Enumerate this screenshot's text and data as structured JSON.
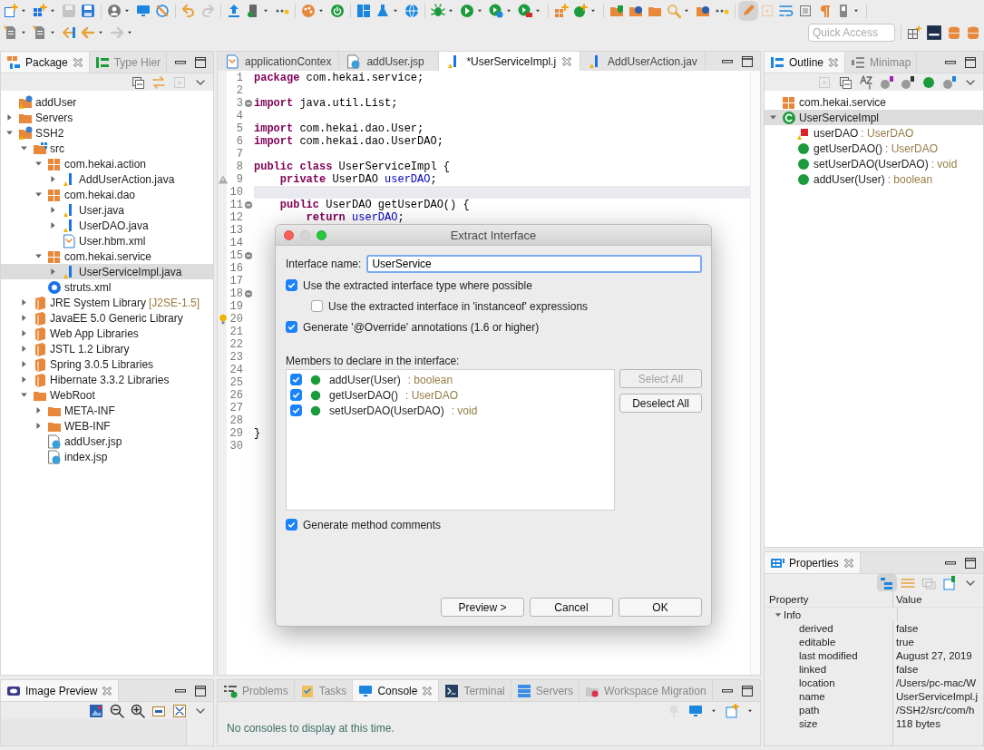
{
  "toolbar": {
    "quick_access": {
      "placeholder": "Quick Access"
    }
  },
  "package_explorer": {
    "tabs": [
      {
        "label": "Package",
        "selected": true
      },
      {
        "label": "Type Hier",
        "selected": false
      }
    ],
    "tree": [
      {
        "label": "addUser",
        "kind": "project",
        "selected": false
      },
      {
        "label": "Servers",
        "kind": "folder",
        "expanded": false,
        "selected": false
      },
      {
        "label": "SSH2",
        "kind": "project",
        "expanded": true,
        "selected": false,
        "children": [
          {
            "label": "src",
            "kind": "source",
            "expanded": true,
            "selected": false,
            "children": [
              {
                "label": "com.hekai.action",
                "kind": "package",
                "expanded": true,
                "selected": false,
                "children": [
                  {
                    "label": "AddUserAction.java",
                    "kind": "java",
                    "expanded": false,
                    "selected": false
                  }
                ]
              },
              {
                "label": "com.hekai.dao",
                "kind": "package",
                "expanded": true,
                "selected": false,
                "children": [
                  {
                    "label": "User.java",
                    "kind": "java",
                    "expanded": false,
                    "selected": false
                  },
                  {
                    "label": "UserDAO.java",
                    "kind": "java",
                    "expanded": false,
                    "selected": false
                  },
                  {
                    "label": "User.hbm.xml",
                    "kind": "xml",
                    "selected": false
                  }
                ]
              },
              {
                "label": "com.hekai.service",
                "kind": "package",
                "expanded": true,
                "selected": false,
                "children": [
                  {
                    "label": "UserServiceImpl.java",
                    "kind": "java",
                    "expanded": false,
                    "selected": true
                  }
                ]
              },
              {
                "label": "struts.xml",
                "kind": "config",
                "selected": false
              }
            ]
          },
          {
            "label": "JRE System Library",
            "suffix": "[J2SE-1.5]",
            "kind": "library",
            "expanded": false,
            "selected": false
          },
          {
            "label": "JavaEE 5.0 Generic Library",
            "kind": "library",
            "expanded": false,
            "selected": false
          },
          {
            "label": "Web App Libraries",
            "kind": "library",
            "expanded": false,
            "selected": false
          },
          {
            "label": "JSTL 1.2 Library",
            "kind": "library",
            "expanded": false,
            "selected": false
          },
          {
            "label": "Spring 3.0.5 Libraries",
            "kind": "library",
            "expanded": false,
            "selected": false
          },
          {
            "label": "Hibernate 3.3.2 Libraries",
            "kind": "library",
            "expanded": false,
            "selected": false
          },
          {
            "label": "WebRoot",
            "kind": "folder",
            "expanded": true,
            "selected": false,
            "children": [
              {
                "label": "META-INF",
                "kind": "folder",
                "expanded": false,
                "selected": false
              },
              {
                "label": "WEB-INF",
                "kind": "folder",
                "expanded": false,
                "selected": false
              },
              {
                "label": "addUser.jsp",
                "kind": "jsp",
                "selected": false
              },
              {
                "label": "index.jsp",
                "kind": "jsp",
                "selected": false
              }
            ]
          }
        ]
      }
    ]
  },
  "editor": {
    "tabs": [
      {
        "label": "applicationContex",
        "kind": "xml",
        "selected": false
      },
      {
        "label": "addUser.jsp",
        "kind": "jsp",
        "selected": false
      },
      {
        "label": "*UserServiceImpl.j",
        "kind": "java",
        "selected": true
      },
      {
        "label": "AddUserAction.jav",
        "kind": "java",
        "selected": false
      }
    ],
    "lines": [
      {
        "n": "1",
        "tokens": [
          {
            "text": "package",
            "kind": "keyword"
          },
          {
            "text": " com.hekai.service;",
            "kind": "plain"
          }
        ]
      },
      {
        "n": "2"
      },
      {
        "n": "3",
        "fold": true,
        "tokens": [
          {
            "text": "import",
            "kind": "keyword"
          },
          {
            "text": " java.util.List;",
            "kind": "plain"
          }
        ]
      },
      {
        "n": "4"
      },
      {
        "n": "5",
        "tokens": [
          {
            "text": "import",
            "kind": "keyword"
          },
          {
            "text": " com.hekai.dao.User;",
            "kind": "plain"
          }
        ]
      },
      {
        "n": "6",
        "tokens": [
          {
            "text": "import",
            "kind": "keyword"
          },
          {
            "text": " com.hekai.dao.UserDAO;",
            "kind": "plain"
          }
        ]
      },
      {
        "n": "7"
      },
      {
        "n": "8",
        "tokens": [
          {
            "text": "public class",
            "kind": "keyword"
          },
          {
            "text": " UserServiceImpl {",
            "kind": "plain"
          }
        ]
      },
      {
        "n": "9",
        "marker": {
          "kind": "warning"
        },
        "tokens": [
          {
            "text": "    private",
            "kind": "keyword"
          },
          {
            "text": " UserDAO ",
            "kind": "plain"
          },
          {
            "text": "userDAO",
            "kind": "field"
          },
          {
            "text": ";",
            "kind": "plain"
          }
        ]
      },
      {
        "n": "10",
        "current": true
      },
      {
        "n": "11",
        "fold": true,
        "tokens": [
          {
            "text": "    public",
            "kind": "keyword"
          },
          {
            "text": " UserDAO getUserDAO() {",
            "kind": "plain"
          }
        ]
      },
      {
        "n": "12",
        "tokens": [
          {
            "text": "        return",
            "kind": "keyword"
          },
          {
            "text": " userDAO",
            "kind": "field"
          },
          {
            "text": ";",
            "kind": "plain"
          }
        ]
      },
      {
        "n": "13"
      },
      {
        "n": "14"
      },
      {
        "n": "15",
        "fold": true
      },
      {
        "n": "16"
      },
      {
        "n": "17"
      },
      {
        "n": "18",
        "fold": true
      },
      {
        "n": "19"
      },
      {
        "n": "20",
        "marker": {
          "kind": "bulb"
        }
      },
      {
        "n": "21"
      },
      {
        "n": "22"
      },
      {
        "n": "23"
      },
      {
        "n": "24"
      },
      {
        "n": "25"
      },
      {
        "n": "26"
      },
      {
        "n": "27"
      },
      {
        "n": "28"
      },
      {
        "n": "29",
        "tokens": [
          {
            "text": "}",
            "kind": "plain"
          }
        ]
      },
      {
        "n": "30"
      }
    ]
  },
  "outline": {
    "tabs": [
      {
        "label": "Outline",
        "selected": true
      },
      {
        "label": "Minimap",
        "selected": false
      }
    ],
    "tree": [
      {
        "label": "com.hekai.service",
        "kind": "package",
        "selected": false
      },
      {
        "label": "UserServiceImpl",
        "kind": "class",
        "expanded": true,
        "selected": true,
        "children": [
          {
            "label": "userDAO",
            "type": ": UserDAO",
            "kind": "field",
            "selected": false
          },
          {
            "label": "getUserDAO()",
            "type": ": UserDAO",
            "kind": "method",
            "selected": false
          },
          {
            "label": "setUserDAO(UserDAO)",
            "type": ": void",
            "kind": "method",
            "selected": false
          },
          {
            "label": "addUser(User)",
            "type": ": boolean",
            "kind": "method",
            "selected": false
          }
        ]
      }
    ]
  },
  "properties": {
    "tab": {
      "label": "Properties"
    },
    "columns": [
      "Property",
      "Value"
    ],
    "group": {
      "label": "Info",
      "expanded": true
    },
    "rows": [
      {
        "property": "derived",
        "value": "false"
      },
      {
        "property": "editable",
        "value": "true"
      },
      {
        "property": "last modified",
        "value": "August 27, 2019"
      },
      {
        "property": "linked",
        "value": "false"
      },
      {
        "property": "location",
        "value": "/Users/pc-mac/W"
      },
      {
        "property": "name",
        "value": "UserServiceImpl.j"
      },
      {
        "property": "path",
        "value": "/SSH2/src/com/h"
      },
      {
        "property": "size",
        "value": "118  bytes"
      }
    ]
  },
  "image_preview": {
    "tab": {
      "label": "Image Preview"
    }
  },
  "console": {
    "tabs": [
      {
        "label": "Problems",
        "kind": "problems",
        "selected": false
      },
      {
        "label": "Tasks",
        "kind": "tasks",
        "selected": false
      },
      {
        "label": "Console",
        "kind": "console",
        "selected": true
      },
      {
        "label": "Terminal",
        "kind": "terminal",
        "selected": false
      },
      {
        "label": "Servers",
        "kind": "servers",
        "selected": false
      },
      {
        "label": "Workspace Migration",
        "kind": "migration",
        "selected": false
      }
    ],
    "message": "No consoles to display at this time."
  },
  "dialog": {
    "title": "Extract Interface",
    "name_label": "Interface name:",
    "name_value": "UserService",
    "options": [
      {
        "label": "Use the extracted interface type where possible",
        "checked": true,
        "children": [
          {
            "label": "Use the extracted interface in 'instanceof' expressions",
            "checked": false
          }
        ]
      },
      {
        "label": "Generate '@Override' annotations (1.6 or higher)",
        "checked": true
      }
    ],
    "members_label": "Members to declare in the interface:",
    "members": [
      {
        "name": "addUser(User)",
        "type": ": boolean",
        "checked": true
      },
      {
        "name": "getUserDAO()",
        "type": ": UserDAO",
        "checked": true
      },
      {
        "name": "setUserDAO(UserDAO)",
        "type": ": void",
        "checked": true
      }
    ],
    "side_buttons": [
      {
        "label": "Select All",
        "disabled": true
      },
      {
        "label": "Deselect All",
        "disabled": false
      }
    ],
    "comments": {
      "label": "Generate method comments",
      "checked": true
    },
    "buttons": [
      "Preview >",
      "Cancel",
      "OK"
    ]
  }
}
